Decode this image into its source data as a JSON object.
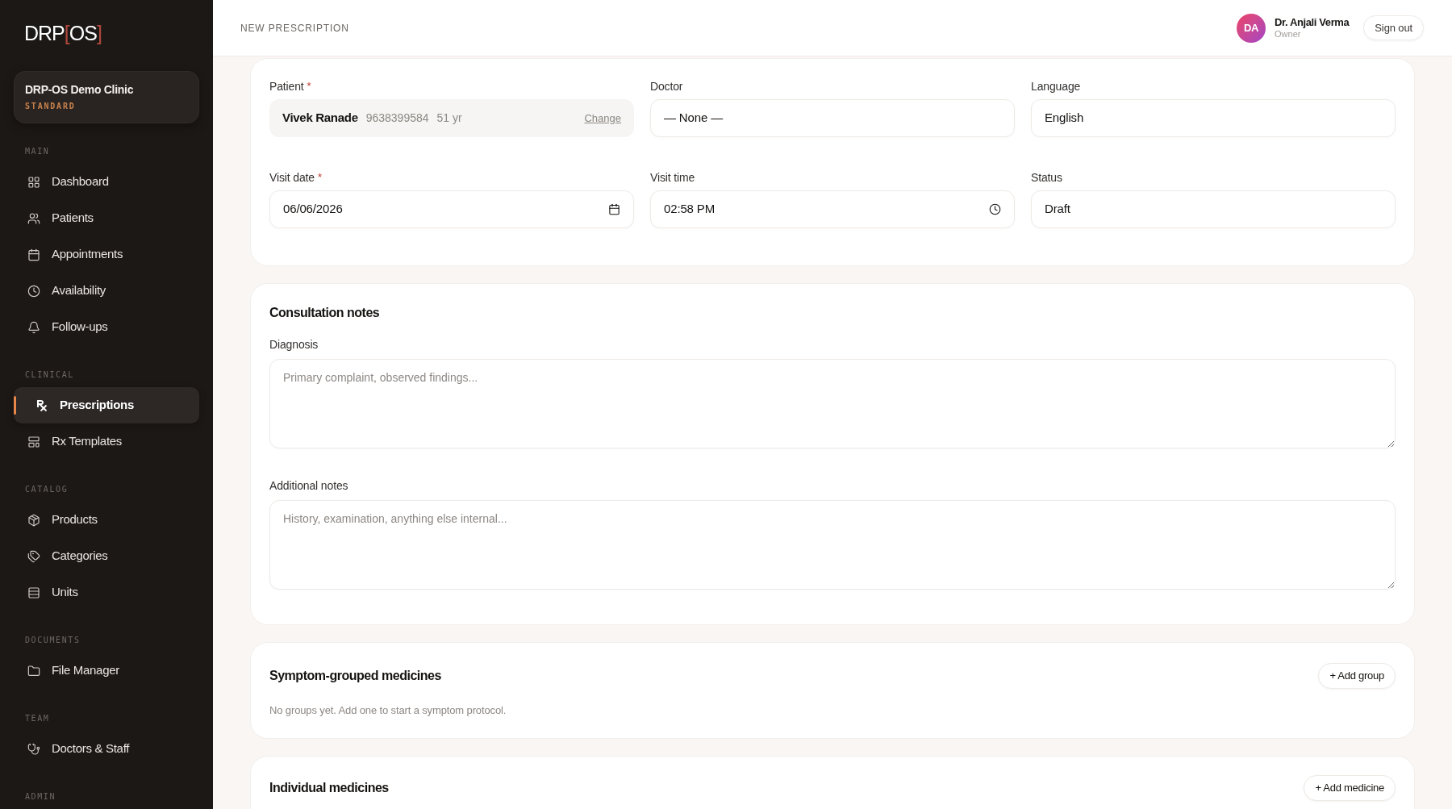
{
  "sidebar": {
    "logo": [
      {
        "text": "DRP",
        "kind": "word"
      },
      {
        "text": "[",
        "kind": "bracket"
      },
      {
        "text": "OS",
        "kind": "word"
      },
      {
        "text": "]",
        "kind": "bracket"
      }
    ],
    "clinic": {
      "name": "DRP-OS Demo Clinic",
      "plan": "STANDARD"
    },
    "sections": [
      {
        "title": "MAIN",
        "items": [
          {
            "label": "Dashboard",
            "selected": false
          },
          {
            "label": "Patients",
            "selected": false
          },
          {
            "label": "Appointments",
            "selected": false
          },
          {
            "label": "Availability",
            "selected": false
          },
          {
            "label": "Follow-ups",
            "selected": false
          }
        ]
      },
      {
        "title": "CLINICAL",
        "items": [
          {
            "label": "Prescriptions",
            "selected": true
          },
          {
            "label": "Rx Templates",
            "selected": false
          }
        ]
      },
      {
        "title": "CATALOG",
        "items": [
          {
            "label": "Products",
            "selected": false
          },
          {
            "label": "Categories",
            "selected": false
          },
          {
            "label": "Units",
            "selected": false
          }
        ]
      },
      {
        "title": "DOCUMENTS",
        "items": [
          {
            "label": "File Manager",
            "selected": false
          }
        ]
      },
      {
        "title": "TEAM",
        "items": [
          {
            "label": "Doctors & Staff",
            "selected": false
          }
        ]
      },
      {
        "title": "ADMIN"
      }
    ]
  },
  "header": {
    "title": "NEW PRESCRIPTION",
    "user": {
      "initials": "DA",
      "name": "Dr. Anjali Verma",
      "role": "Owner"
    },
    "sign_out": "Sign out"
  },
  "visit": {
    "fields": [
      {
        "kind": "patient",
        "label": "Patient",
        "required_mark": "*",
        "name": "Vivek Ranade",
        "phone": "9638399584",
        "age": "51 yr",
        "action": "Change"
      },
      {
        "kind": "select",
        "label": "Doctor",
        "value": "— None —"
      },
      {
        "kind": "select",
        "label": "Language",
        "value": "English"
      },
      {
        "kind": "date",
        "label": "Visit date",
        "required_mark": "*",
        "value": "06/06/2026"
      },
      {
        "kind": "time",
        "label": "Visit time",
        "value": "02:58 PM"
      },
      {
        "kind": "select",
        "label": "Status",
        "value": "Draft"
      }
    ]
  },
  "notes": {
    "title": "Consultation notes",
    "fields": [
      {
        "label": "Diagnosis",
        "placeholder": "Primary complaint, observed findings..."
      },
      {
        "label": "Additional notes",
        "placeholder": "History, examination, anything else internal..."
      }
    ]
  },
  "medicines": [
    {
      "title": "Symptom-grouped medicines",
      "button": "+ Add group",
      "empty_text": "No groups yet. Add one to start a symptom protocol."
    },
    {
      "title": "Individual medicines",
      "button": "+ Add medicine"
    }
  ]
}
